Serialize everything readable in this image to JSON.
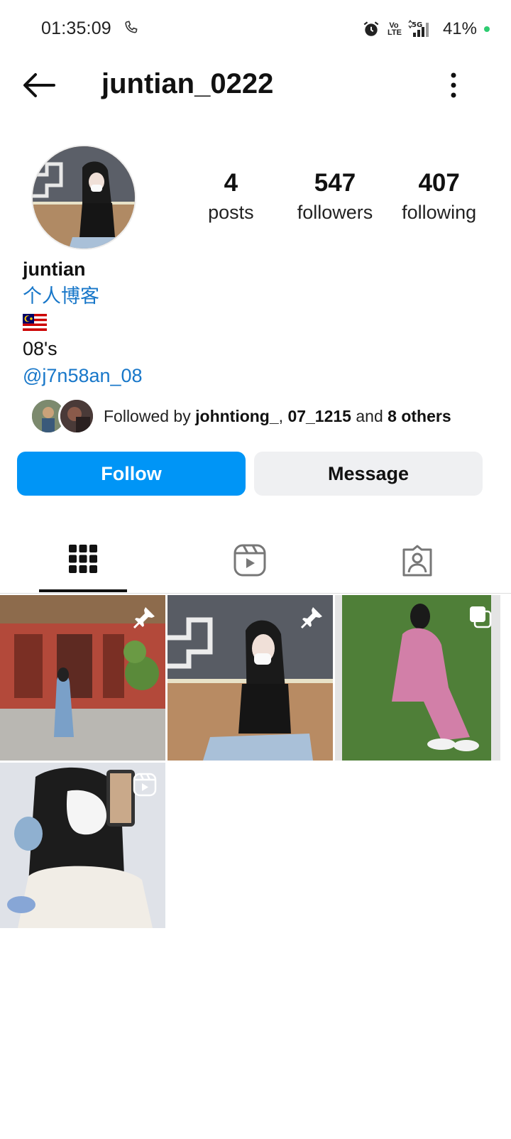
{
  "status_bar": {
    "time": "01:35:09",
    "volte_top": "Vo",
    "volte_bottom": "LTE",
    "network": "5G",
    "battery": "41%",
    "battery_dot_color": "#2ecc71"
  },
  "header": {
    "username": "juntian_0222",
    "back_icon": "arrow-left-icon",
    "menu_icon": "more-vertical-icon"
  },
  "stats": [
    {
      "value": "4",
      "label": "posts"
    },
    {
      "value": "547",
      "label": "followers"
    },
    {
      "value": "407",
      "label": "following"
    }
  ],
  "bio": {
    "name": "juntian",
    "category": "个人博客",
    "flag": "malaysia-flag-emoji",
    "text": "08's",
    "mention": "@j7n58an_08"
  },
  "followed_by": {
    "prefix": "Followed by ",
    "user1": "johntiong_",
    "separator": ", ",
    "user2": "07_1215",
    "conjunction": " and ",
    "others": "8 others"
  },
  "actions": {
    "follow_label": "Follow",
    "message_label": "Message",
    "follow_color": "#0095f6"
  },
  "tabs": [
    {
      "name": "posts-grid",
      "icon": "grid-icon",
      "active": true
    },
    {
      "name": "reels",
      "icon": "reels-icon",
      "active": false
    },
    {
      "name": "tagged",
      "icon": "tagged-person-icon",
      "active": false
    }
  ],
  "posts": [
    {
      "badge": "pin-icon"
    },
    {
      "badge": "pin-icon"
    },
    {
      "badge": "carousel-icon"
    },
    {
      "badge": "reel-icon"
    }
  ]
}
